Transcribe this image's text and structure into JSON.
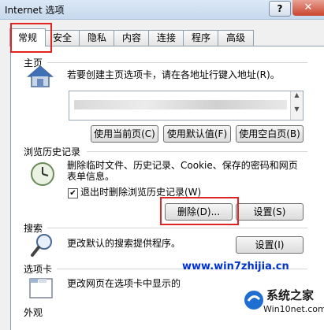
{
  "window": {
    "title": "Internet 选项",
    "help_label": "?",
    "close_label": "✕"
  },
  "tabs": [
    "常规",
    "安全",
    "隐私",
    "内容",
    "连接",
    "程序",
    "高级"
  ],
  "homepage": {
    "section_label": "主页",
    "description": "若要创建主页选项卡，请在各地址行键入地址(R)。",
    "buttons": [
      "使用当前页(C)",
      "使用默认值(F)",
      "使用空白页(B)"
    ]
  },
  "history": {
    "section_label": "浏览历史记录",
    "description_line1": "删除临时文件、历史记录、Cookie、保存的密码和网页",
    "description_line2": "表单信息。",
    "checkbox_label": "退出时删除浏览历史记录(W)",
    "checkbox_checked": true,
    "delete_button": "删除(D)...",
    "settings_button": "设置(S)"
  },
  "search": {
    "section_label": "搜索",
    "description": "更改默认的搜索提供程序。",
    "settings_button": "设置(I)"
  },
  "tabs_section": {
    "section_label": "选项卡",
    "description": "更改网页在选项卡中显示的"
  },
  "appearance": {
    "section_label": "外观"
  },
  "watermarks": {
    "top": "www.win7zhijia.cn",
    "bottom": "系统之家",
    "bottom_url": "Win10net.com"
  },
  "colors": {
    "highlight": "#e02424",
    "accent": "#0033cc"
  }
}
